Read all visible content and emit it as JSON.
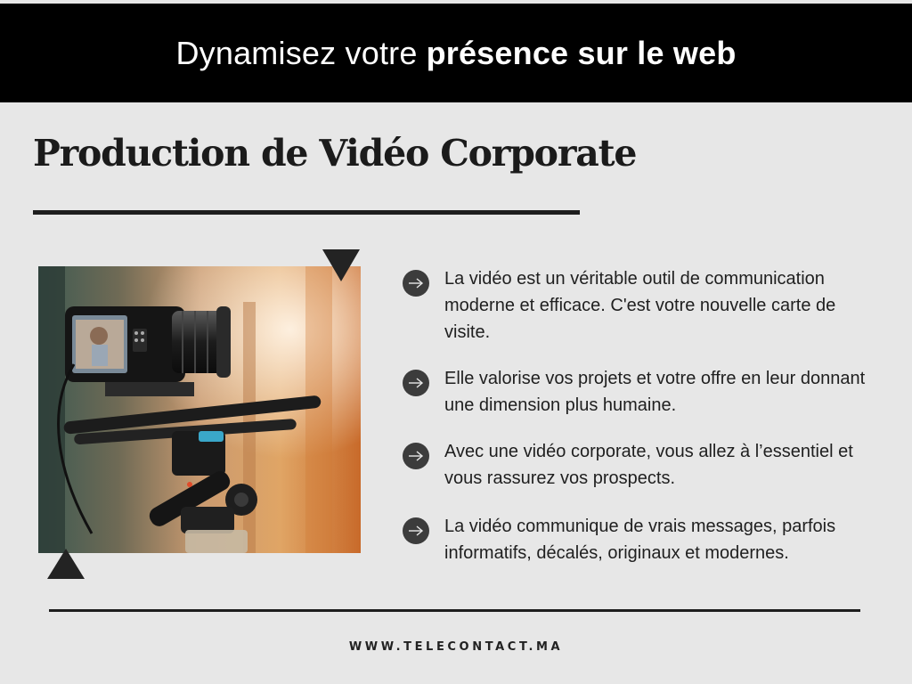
{
  "header": {
    "title_light": "Dynamisez votre",
    "title_bold": "présence sur le web"
  },
  "page_title": "Production de Vidéo Corporate",
  "photo": {
    "subject": "video camera on rig"
  },
  "bullets": [
    {
      "icon": "arrow-right-icon",
      "text": "La vidéo est un véritable outil de communication moderne et efficace. C'est votre nouvelle carte de visite."
    },
    {
      "icon": "arrow-right-icon",
      "text": "Elle valorise vos projets et votre offre en leur donnant une dimension plus humaine."
    },
    {
      "icon": "arrow-right-icon",
      "text": "Avec une vidéo corporate, vous allez à l’essentiel et vous rassurez vos prospects."
    },
    {
      "icon": "arrow-right-icon",
      "text": "La vidéo communique de vrais messages, parfois informatifs, décalés, originaux et modernes."
    }
  ],
  "footer": {
    "url": "WWW.TELECONTACT.MA"
  },
  "colors": {
    "background": "#e7e7e7",
    "header_band": "#000000",
    "text_dark": "#1f1f1f",
    "bullet_icon": "#3c3c3c"
  }
}
